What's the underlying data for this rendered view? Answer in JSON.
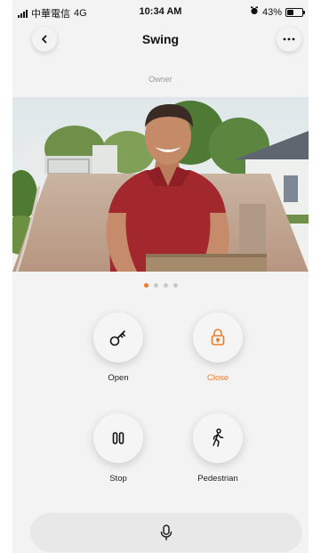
{
  "status_bar": {
    "carrier": "中華電信",
    "network": "4G",
    "time": "10:34 AM",
    "battery_percent": "43%",
    "battery_level": 0.43
  },
  "nav": {
    "title": "Swing",
    "back_icon": "chevron-left-icon",
    "more_icon": "ellipsis-icon"
  },
  "role_label": "Owner",
  "camera": {
    "pages": 4,
    "active_page": 1
  },
  "actions": {
    "open": {
      "label": "Open",
      "icon": "key-icon"
    },
    "close": {
      "label": "Close",
      "icon": "padlock-icon"
    },
    "stop": {
      "label": "Stop",
      "icon": "pause-icon"
    },
    "pedestrian": {
      "label": "Pedestrian",
      "icon": "walking-person-icon"
    }
  },
  "mic": {
    "icon": "microphone-icon"
  },
  "colors": {
    "accent": "#f07a2a",
    "background": "#f3f3f3",
    "text": "#222222",
    "muted": "#999999"
  }
}
